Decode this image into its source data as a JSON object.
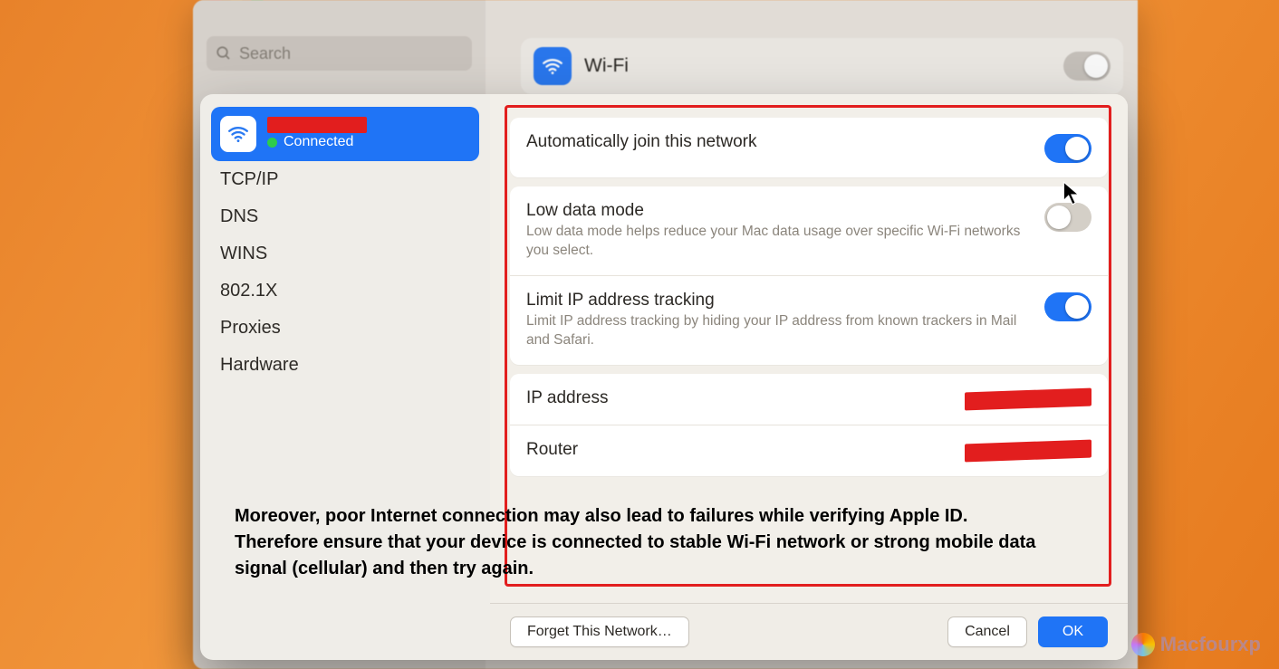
{
  "bg": {
    "search_placeholder": "Search",
    "wifi_label": "Wi-Fi"
  },
  "sidebar": {
    "network": {
      "status": "Connected"
    },
    "items": [
      {
        "label": "TCP/IP"
      },
      {
        "label": "DNS"
      },
      {
        "label": "WINS"
      },
      {
        "label": "802.1X"
      },
      {
        "label": "Proxies"
      },
      {
        "label": "Hardware"
      }
    ]
  },
  "settings": {
    "auto_join": {
      "title": "Automatically join this network",
      "enabled": true
    },
    "low_data": {
      "title": "Low data mode",
      "desc": "Low data mode helps reduce your Mac data usage over specific Wi-Fi networks you select.",
      "enabled": false
    },
    "limit_ip": {
      "title": "Limit IP address tracking",
      "desc": "Limit IP address tracking by hiding your IP address from known trackers in Mail and Safari.",
      "enabled": true
    },
    "ip": {
      "label": "IP address"
    },
    "router": {
      "label": "Router"
    }
  },
  "footer": {
    "forget": "Forget This Network…",
    "cancel": "Cancel",
    "ok": "OK"
  },
  "caption": "Moreover, poor Internet connection may also lead to failures while verifying Apple ID. Therefore ensure that your device is connected to stable Wi-Fi network or strong  mobile data signal (cellular) and then try again.",
  "watermark": "Macfourxp"
}
